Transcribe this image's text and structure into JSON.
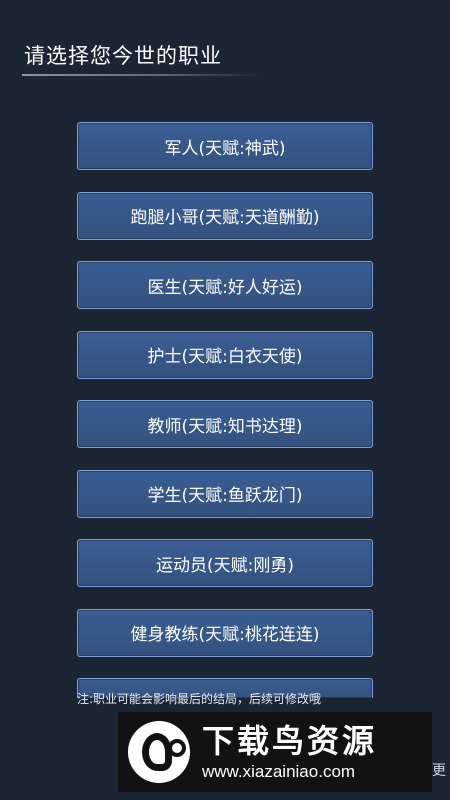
{
  "header": {
    "title": "请选择您今世的职业"
  },
  "careers": [
    {
      "label": "军人(天赋:神武)"
    },
    {
      "label": "跑腿小哥(天赋:天道酬勤)"
    },
    {
      "label": "医生(天赋:好人好运)"
    },
    {
      "label": "护士(天赋:白衣天使)"
    },
    {
      "label": "教师(天赋:知书达理)"
    },
    {
      "label": "学生(天赋:鱼跃龙门)"
    },
    {
      "label": "运动员(天赋:刚勇)"
    },
    {
      "label": "健身教练(天赋:桃花连连)"
    }
  ],
  "note": "注:职业可能会影响最后的结局，后续可修改哦",
  "watermark": {
    "title": "下载鸟资源",
    "url": "www.xiazainiao.com"
  },
  "edge_glyph": "更",
  "colors": {
    "background": "#1b2533",
    "button_fill": "#3b5d92",
    "button_border": "#7fa1d1"
  }
}
